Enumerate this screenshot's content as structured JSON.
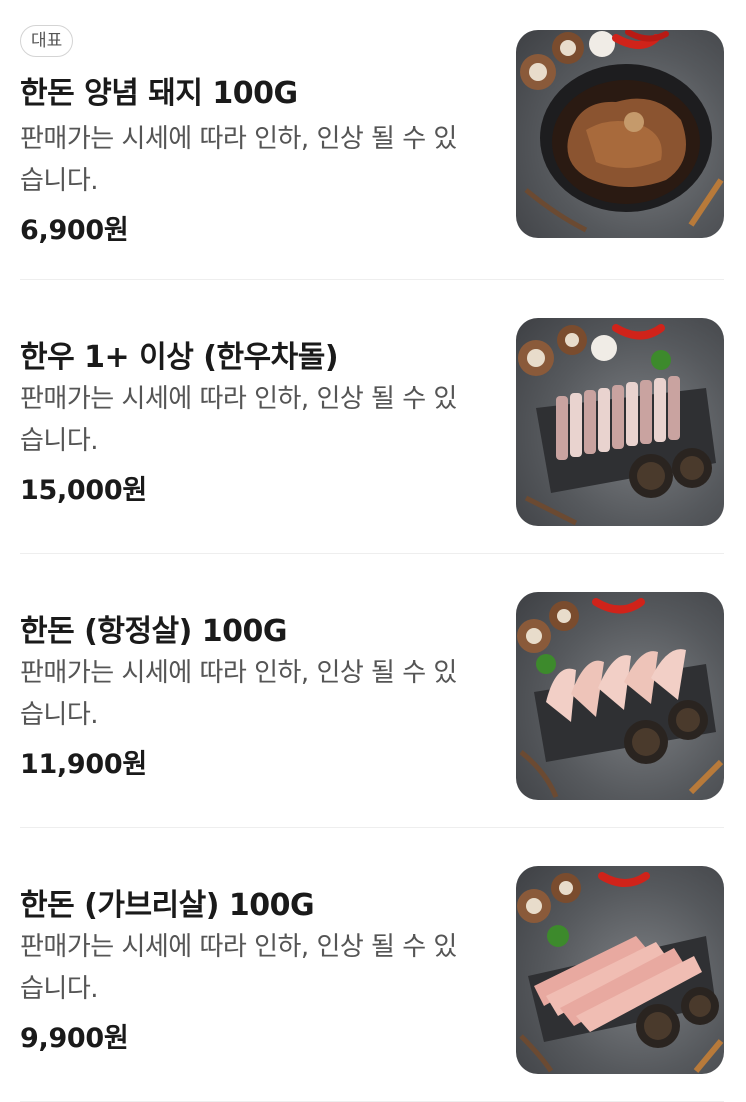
{
  "badge_label": "대표",
  "items": [
    {
      "name": "한돈 양념 돼지 100G",
      "description": "판매가는 시세에 따라 인하, 인상 될 수 있습니다.",
      "price": "6,900원",
      "image_icon": "marinated-pork-photo"
    },
    {
      "name": "한우 1+ 이상 (한우차돌)",
      "description": "판매가는 시세에 따라 인하, 인상 될 수 있습니다.",
      "price": "15,000원",
      "image_icon": "beef-brisket-photo"
    },
    {
      "name": "한돈 (항정살) 100G",
      "description": "판매가는 시세에 따라 인하, 인상 될 수 있습니다.",
      "price": "11,900원",
      "image_icon": "pork-jowl-photo"
    },
    {
      "name": "한돈 (가브리살) 100G",
      "description": "판매가는 시세에 따라 인하, 인상 될 수 있습니다.",
      "price": "9,900원",
      "image_icon": "pork-neck-photo"
    }
  ]
}
